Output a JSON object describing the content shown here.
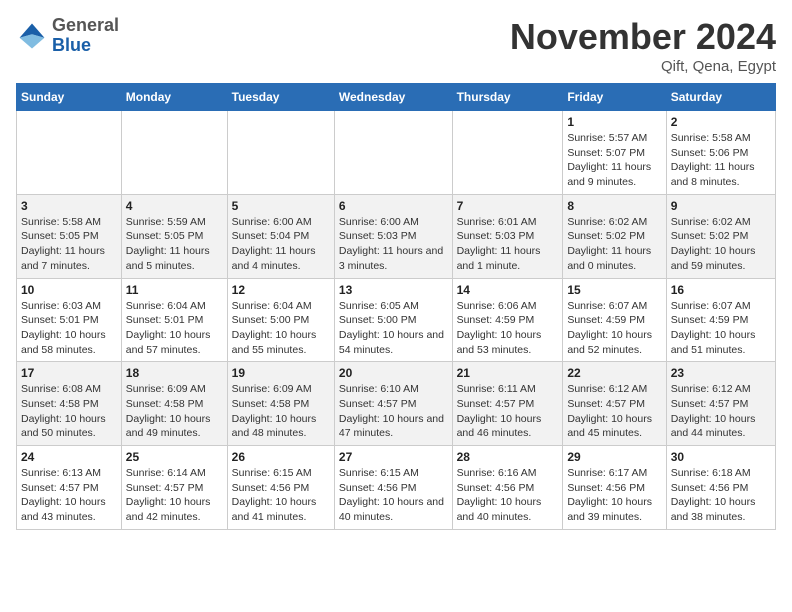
{
  "logo": {
    "general": "General",
    "blue": "Blue"
  },
  "header": {
    "month": "November 2024",
    "location": "Qift, Qena, Egypt"
  },
  "weekdays": [
    "Sunday",
    "Monday",
    "Tuesday",
    "Wednesday",
    "Thursday",
    "Friday",
    "Saturday"
  ],
  "weeks": [
    [
      {
        "day": "",
        "info": ""
      },
      {
        "day": "",
        "info": ""
      },
      {
        "day": "",
        "info": ""
      },
      {
        "day": "",
        "info": ""
      },
      {
        "day": "",
        "info": ""
      },
      {
        "day": "1",
        "info": "Sunrise: 5:57 AM\nSunset: 5:07 PM\nDaylight: 11 hours and 9 minutes."
      },
      {
        "day": "2",
        "info": "Sunrise: 5:58 AM\nSunset: 5:06 PM\nDaylight: 11 hours and 8 minutes."
      }
    ],
    [
      {
        "day": "3",
        "info": "Sunrise: 5:58 AM\nSunset: 5:05 PM\nDaylight: 11 hours and 7 minutes."
      },
      {
        "day": "4",
        "info": "Sunrise: 5:59 AM\nSunset: 5:05 PM\nDaylight: 11 hours and 5 minutes."
      },
      {
        "day": "5",
        "info": "Sunrise: 6:00 AM\nSunset: 5:04 PM\nDaylight: 11 hours and 4 minutes."
      },
      {
        "day": "6",
        "info": "Sunrise: 6:00 AM\nSunset: 5:03 PM\nDaylight: 11 hours and 3 minutes."
      },
      {
        "day": "7",
        "info": "Sunrise: 6:01 AM\nSunset: 5:03 PM\nDaylight: 11 hours and 1 minute."
      },
      {
        "day": "8",
        "info": "Sunrise: 6:02 AM\nSunset: 5:02 PM\nDaylight: 11 hours and 0 minutes."
      },
      {
        "day": "9",
        "info": "Sunrise: 6:02 AM\nSunset: 5:02 PM\nDaylight: 10 hours and 59 minutes."
      }
    ],
    [
      {
        "day": "10",
        "info": "Sunrise: 6:03 AM\nSunset: 5:01 PM\nDaylight: 10 hours and 58 minutes."
      },
      {
        "day": "11",
        "info": "Sunrise: 6:04 AM\nSunset: 5:01 PM\nDaylight: 10 hours and 57 minutes."
      },
      {
        "day": "12",
        "info": "Sunrise: 6:04 AM\nSunset: 5:00 PM\nDaylight: 10 hours and 55 minutes."
      },
      {
        "day": "13",
        "info": "Sunrise: 6:05 AM\nSunset: 5:00 PM\nDaylight: 10 hours and 54 minutes."
      },
      {
        "day": "14",
        "info": "Sunrise: 6:06 AM\nSunset: 4:59 PM\nDaylight: 10 hours and 53 minutes."
      },
      {
        "day": "15",
        "info": "Sunrise: 6:07 AM\nSunset: 4:59 PM\nDaylight: 10 hours and 52 minutes."
      },
      {
        "day": "16",
        "info": "Sunrise: 6:07 AM\nSunset: 4:59 PM\nDaylight: 10 hours and 51 minutes."
      }
    ],
    [
      {
        "day": "17",
        "info": "Sunrise: 6:08 AM\nSunset: 4:58 PM\nDaylight: 10 hours and 50 minutes."
      },
      {
        "day": "18",
        "info": "Sunrise: 6:09 AM\nSunset: 4:58 PM\nDaylight: 10 hours and 49 minutes."
      },
      {
        "day": "19",
        "info": "Sunrise: 6:09 AM\nSunset: 4:58 PM\nDaylight: 10 hours and 48 minutes."
      },
      {
        "day": "20",
        "info": "Sunrise: 6:10 AM\nSunset: 4:57 PM\nDaylight: 10 hours and 47 minutes."
      },
      {
        "day": "21",
        "info": "Sunrise: 6:11 AM\nSunset: 4:57 PM\nDaylight: 10 hours and 46 minutes."
      },
      {
        "day": "22",
        "info": "Sunrise: 6:12 AM\nSunset: 4:57 PM\nDaylight: 10 hours and 45 minutes."
      },
      {
        "day": "23",
        "info": "Sunrise: 6:12 AM\nSunset: 4:57 PM\nDaylight: 10 hours and 44 minutes."
      }
    ],
    [
      {
        "day": "24",
        "info": "Sunrise: 6:13 AM\nSunset: 4:57 PM\nDaylight: 10 hours and 43 minutes."
      },
      {
        "day": "25",
        "info": "Sunrise: 6:14 AM\nSunset: 4:57 PM\nDaylight: 10 hours and 42 minutes."
      },
      {
        "day": "26",
        "info": "Sunrise: 6:15 AM\nSunset: 4:56 PM\nDaylight: 10 hours and 41 minutes."
      },
      {
        "day": "27",
        "info": "Sunrise: 6:15 AM\nSunset: 4:56 PM\nDaylight: 10 hours and 40 minutes."
      },
      {
        "day": "28",
        "info": "Sunrise: 6:16 AM\nSunset: 4:56 PM\nDaylight: 10 hours and 40 minutes."
      },
      {
        "day": "29",
        "info": "Sunrise: 6:17 AM\nSunset: 4:56 PM\nDaylight: 10 hours and 39 minutes."
      },
      {
        "day": "30",
        "info": "Sunrise: 6:18 AM\nSunset: 4:56 PM\nDaylight: 10 hours and 38 minutes."
      }
    ]
  ]
}
